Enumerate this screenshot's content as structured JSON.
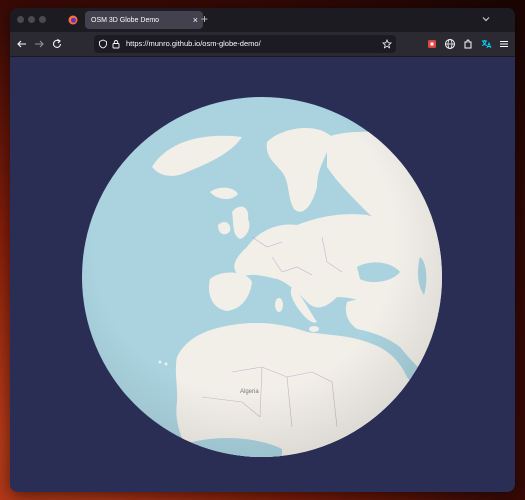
{
  "browser": {
    "tab_title": "OSM 3D Globe Demo",
    "tab_close": "×",
    "new_tab": "+",
    "url": "https://munro.github.io/osm-globe-demo/"
  },
  "map": {
    "labels": {
      "algeria": "Algeria"
    }
  },
  "colors": {
    "background": "#2a2e54",
    "ocean": "#aad3df",
    "land": "#f2efe9",
    "toolbar": "#2b2a33"
  }
}
